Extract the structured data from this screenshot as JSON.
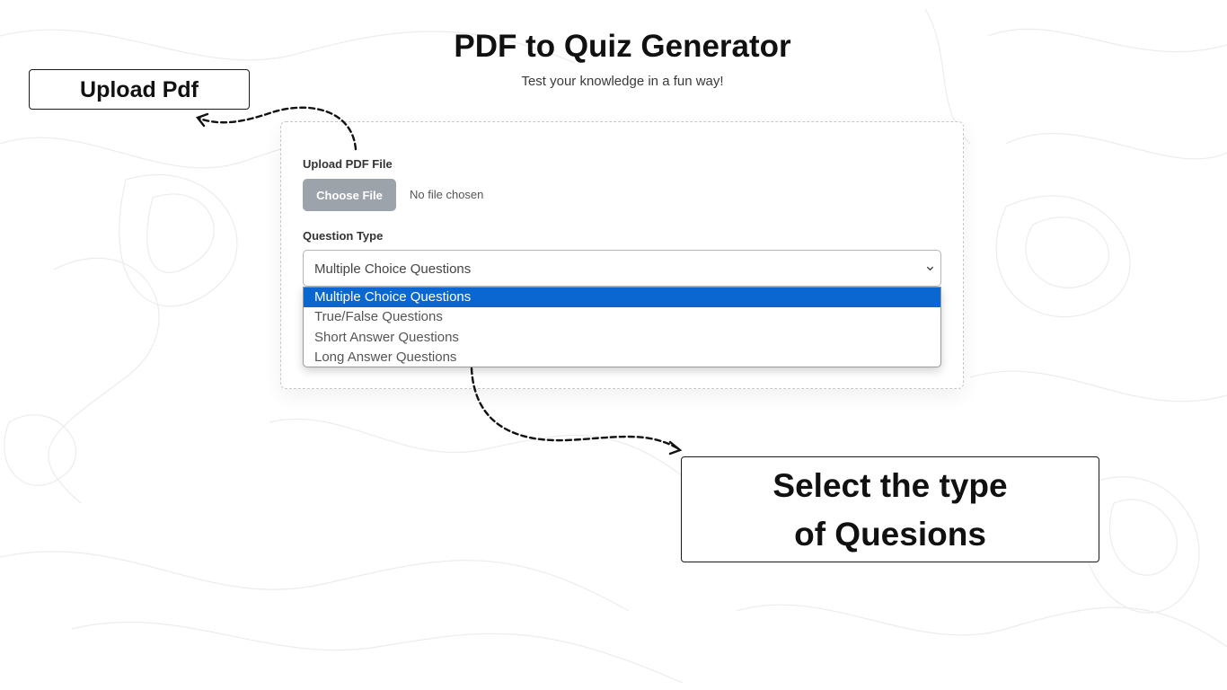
{
  "page": {
    "title": "PDF to Quiz Generator",
    "subtitle": "Test your knowledge in a fun way!"
  },
  "form": {
    "upload_label": "Upload PDF File",
    "choose_file_button": "Choose File",
    "file_status": "No file chosen",
    "question_type_label": "Question Type",
    "question_type_selected": "Multiple Choice Questions",
    "question_type_options": [
      "Multiple Choice Questions",
      "True/False Questions",
      "Short Answer Questions",
      "Long Answer Questions"
    ]
  },
  "annotations": {
    "upload_callout": "Upload Pdf",
    "select_callout_line1": "Select the type",
    "select_callout_line2": "of Quesions"
  },
  "colors": {
    "highlight": "#0a66d0",
    "choose_file_button": "#9da3aa",
    "title_text": "#111111"
  },
  "icons": {
    "select_chevron": "chevron-down-icon",
    "arrow": "dashed-arrow-icon"
  }
}
